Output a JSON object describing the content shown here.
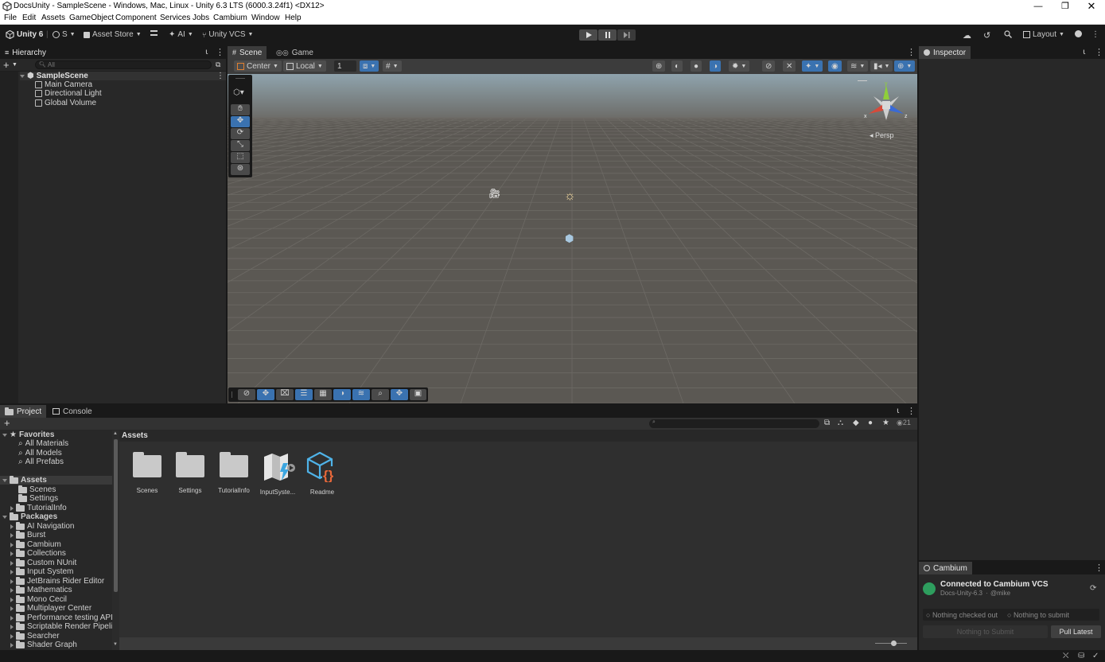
{
  "window": {
    "title": "DocsUnity - SampleScene - Windows, Mac, Linux - Unity 6.3 LTS (6000.3.24f1) <DX12>"
  },
  "menu": [
    "File",
    "Edit",
    "Assets",
    "GameObject",
    "Component",
    "Services",
    "Jobs",
    "Cambium",
    "Window",
    "Help"
  ],
  "toolbar": {
    "unity_label": "Unity 6",
    "account_label": "S",
    "asset_store_label": "Asset Store",
    "ai_label": "AI",
    "vcs_label": "Unity VCS",
    "layout_label": "Layout"
  },
  "hierarchy": {
    "tab_label": "Hierarchy",
    "search_placeholder": "All",
    "scene_name": "SampleScene",
    "items": [
      "Main Camera",
      "Directional Light",
      "Global Volume"
    ]
  },
  "scene_view": {
    "tabs": [
      "Scene",
      "Game"
    ],
    "pivot_label": "Center",
    "space_label": "Local",
    "grid_snap_value": "1",
    "persp_label": "Persp",
    "gizmo_axes": [
      "y",
      "x",
      "z"
    ]
  },
  "inspector": {
    "tab_label": "Inspector"
  },
  "project": {
    "tabs": [
      "Project",
      "Console"
    ],
    "favorites_label": "Favorites",
    "favorites": [
      "All Materials",
      "All Models",
      "All Prefabs"
    ],
    "assets_label": "Assets",
    "assets_children": [
      "Scenes",
      "Settings",
      "TutorialInfo"
    ],
    "packages_label": "Packages",
    "packages": [
      "AI Navigation",
      "Burst",
      "Cambium",
      "Collections",
      "Custom NUnit",
      "Input System",
      "JetBrains Rider Editor",
      "Mathematics",
      "Mono Cecil",
      "Multiplayer Center",
      "Performance testing API",
      "Scriptable Render Pipeline",
      "Searcher",
      "Shader Graph"
    ],
    "breadcrumb": "Assets",
    "grid_items": [
      "Scenes",
      "Settings",
      "TutorialInfo",
      "InputSyste...",
      "Readme"
    ],
    "hidden_count": "21"
  },
  "cambium": {
    "tab_label": "Cambium",
    "status": "Connected to Cambium VCS",
    "repo": "Docs-Unity-6.3",
    "user": "@mike",
    "nothing_checked_out": "Nothing checked out",
    "nothing_to_submit": "Nothing to submit",
    "submit_button": "Nothing to Submit",
    "pull_button": "Pull Latest"
  },
  "colors": {
    "accent_blue": "#3a72b0",
    "connected_green": "#2e9e5e",
    "readme_orange": "#e8683a",
    "readme_blue": "#4fb3e8"
  }
}
